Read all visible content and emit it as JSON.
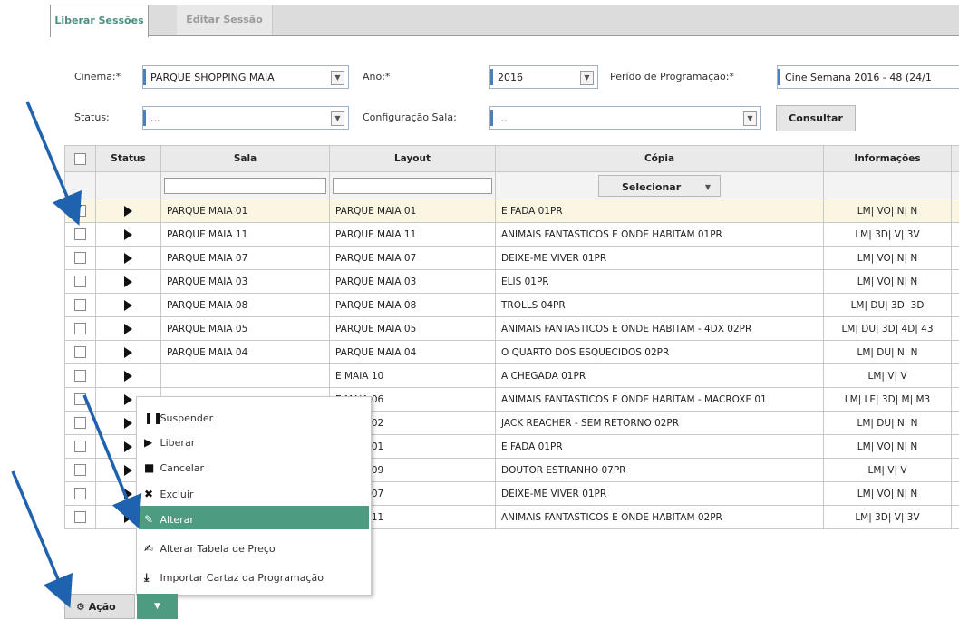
{
  "tabs": [
    {
      "label": "Liberar Sessões",
      "active": true
    },
    {
      "label": "Editar Sessão",
      "active": false
    }
  ],
  "filters": {
    "cinema_label": "Cinema:*",
    "cinema_value": "PARQUE SHOPPING MAIA",
    "ano_label": "Ano:*",
    "ano_value": "2016",
    "periodo_label": "Perído de Programação:*",
    "periodo_value": "Cine Semana 2016 - 48 (24/1",
    "status_label": "Status:",
    "status_value": "...",
    "config_label": "Configuração Sala:",
    "config_value": "...",
    "consultar_label": "Consultar"
  },
  "table": {
    "headers": [
      "Status",
      "Sala",
      "Layout",
      "Cópia",
      "Informações"
    ],
    "selecionar_label": "Selecionar",
    "rows": [
      {
        "checked": true,
        "sala": "PARQUE MAIA 01",
        "layout": "PARQUE MAIA 01",
        "copia": "E FADA 01PR",
        "info": "LM| VO| N| N"
      },
      {
        "checked": false,
        "sala": "PARQUE MAIA 11",
        "layout": "PARQUE MAIA 11",
        "copia": "ANIMAIS FANTASTICOS E ONDE HABITAM 01PR",
        "info": "LM| 3D| V| 3V"
      },
      {
        "checked": false,
        "sala": "PARQUE MAIA 07",
        "layout": "PARQUE MAIA 07",
        "copia": "DEIXE-ME VIVER 01PR",
        "info": "LM| VO| N| N"
      },
      {
        "checked": false,
        "sala": "PARQUE MAIA 03",
        "layout": "PARQUE MAIA 03",
        "copia": "ELIS 01PR",
        "info": "LM| VO| N| N"
      },
      {
        "checked": false,
        "sala": "PARQUE MAIA 08",
        "layout": "PARQUE MAIA 08",
        "copia": "TROLLS 04PR",
        "info": "LM| DU| 3D| 3D"
      },
      {
        "checked": false,
        "sala": "PARQUE MAIA 05",
        "layout": "PARQUE MAIA 05",
        "copia": "ANIMAIS FANTASTICOS E ONDE HABITAM - 4DX 02PR",
        "info": "LM| DU| 3D| 4D| 43"
      },
      {
        "checked": false,
        "sala": "PARQUE MAIA 04",
        "layout": "PARQUE MAIA 04",
        "copia": "O QUARTO DOS ESQUECIDOS 02PR",
        "info": "LM| DU| N| N"
      },
      {
        "checked": false,
        "sala": "",
        "layout": "E MAIA 10",
        "copia": "A CHEGADA 01PR",
        "info": "LM| V| V"
      },
      {
        "checked": false,
        "sala": "",
        "layout": "E MAIA 06",
        "copia": "ANIMAIS FANTASTICOS E ONDE HABITAM - MACROXE 01",
        "info": "LM| LE| 3D| M| M3"
      },
      {
        "checked": false,
        "sala": "",
        "layout": "E MAIA 02",
        "copia": "JACK REACHER - SEM RETORNO 02PR",
        "info": "LM| DU| N| N"
      },
      {
        "checked": false,
        "sala": "",
        "layout": "E MAIA 01",
        "copia": "E FADA 01PR",
        "info": "LM| VO| N| N"
      },
      {
        "checked": false,
        "sala": "",
        "layout": "E MAIA 09",
        "copia": "DOUTOR ESTRANHO 07PR",
        "info": "LM| V| V"
      },
      {
        "checked": false,
        "sala": "",
        "layout": "E MAIA 07",
        "copia": "DEIXE-ME VIVER 01PR",
        "info": "LM| VO| N| N"
      },
      {
        "checked": false,
        "sala": "",
        "layout": "E MAIA 11",
        "copia": "ANIMAIS FANTASTICOS E ONDE HABITAM 02PR",
        "info": "LM| 3D| V| 3V"
      }
    ]
  },
  "menu": {
    "items": [
      {
        "label": "Suspender",
        "icon": "pause-icon"
      },
      {
        "label": "Liberar",
        "icon": "play-icon"
      },
      {
        "label": "Cancelar",
        "icon": "stop-icon"
      },
      {
        "label": "Excluir",
        "icon": "x-icon"
      },
      {
        "label": "Alterar",
        "icon": "pencil-icon",
        "highlighted": true
      },
      {
        "label": "Alterar Tabela de Preço",
        "icon": "edit-icon"
      },
      {
        "label": "Importar Cartaz da Programação",
        "icon": "download-icon"
      }
    ]
  },
  "acao_label": "Ação",
  "colors": {
    "accent": "#4d9b80",
    "tab_active": "#4b8f83",
    "arrow": "#1f63b0"
  }
}
